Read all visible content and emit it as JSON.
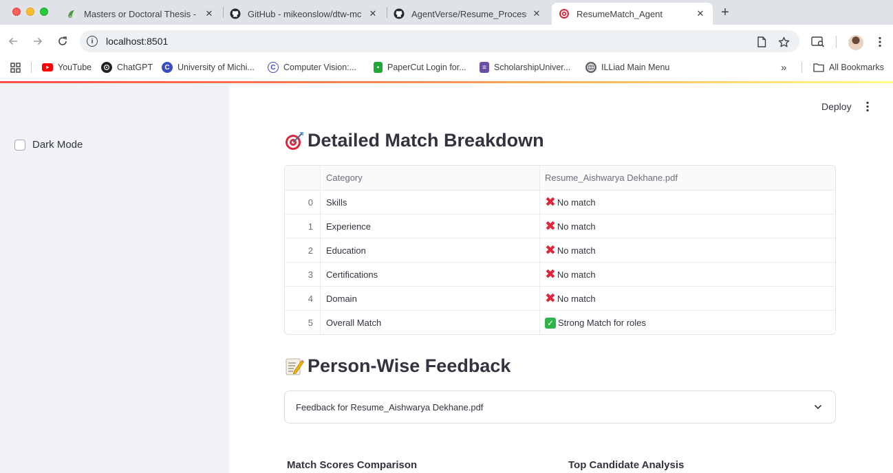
{
  "browser": {
    "tabs": [
      {
        "title": "Masters or Doctoral Thesis - ",
        "icon": "overleaf-icon"
      },
      {
        "title": "GitHub - mikeonslow/dtw-mc",
        "icon": "github-icon"
      },
      {
        "title": "AgentVerse/Resume_Process",
        "icon": "github-icon"
      },
      {
        "title": "ResumeMatch_Agent",
        "icon": "streamlit-target-icon"
      }
    ],
    "url": "localhost:8501",
    "bookmarks": [
      {
        "label": "YouTube",
        "icon": "youtube-icon",
        "color": "#ff0000"
      },
      {
        "label": "ChatGPT",
        "icon": "openai-icon",
        "color": "#202124"
      },
      {
        "label": "University of Michi...",
        "icon": "umich-icon",
        "color": "#3b4cc0"
      },
      {
        "label": "Computer Vision:...",
        "icon": "cv-icon",
        "color": "#3b4cc0"
      },
      {
        "label": "PaperCut Login for...",
        "icon": "papercut-icon",
        "color": "#1fa73a"
      },
      {
        "label": "ScholarshipUniver...",
        "icon": "scholarship-icon",
        "color": "#6b4ca6"
      },
      {
        "label": "ILLiad Main Menu",
        "icon": "globe-icon",
        "color": "#5f6368"
      }
    ],
    "all_bookmarks_label": "All Bookmarks"
  },
  "sidebar": {
    "dark_mode_label": "Dark Mode",
    "dark_mode_checked": false
  },
  "header": {
    "deploy_label": "Deploy"
  },
  "main": {
    "breakdown_title": "Detailed Match Breakdown",
    "table": {
      "columns": [
        "",
        "Category",
        "Resume_Aishwarya Dekhane.pdf"
      ],
      "rows": [
        {
          "index": "0",
          "category": "Skills",
          "result": "No match",
          "status": "no"
        },
        {
          "index": "1",
          "category": "Experience",
          "result": "No match",
          "status": "no"
        },
        {
          "index": "2",
          "category": "Education",
          "result": "No match",
          "status": "no"
        },
        {
          "index": "3",
          "category": "Certifications",
          "result": "No match",
          "status": "no"
        },
        {
          "index": "4",
          "category": "Domain",
          "result": "No match",
          "status": "no"
        },
        {
          "index": "5",
          "category": "Overall Match",
          "result": "Strong Match for  roles",
          "status": "yes"
        }
      ]
    },
    "feedback_title": "Person-Wise Feedback",
    "expander_label": "Feedback for Resume_Aishwarya Dekhane.pdf",
    "scores_title": "Match Scores Comparison",
    "top_candidate_title": "Top Candidate Analysis"
  },
  "colors": {
    "accent": "#ff4b4b",
    "sidebar_bg": "#f0f2f6",
    "text": "#31333f",
    "no_match": "#e0243a",
    "match": "#2fb34a"
  }
}
